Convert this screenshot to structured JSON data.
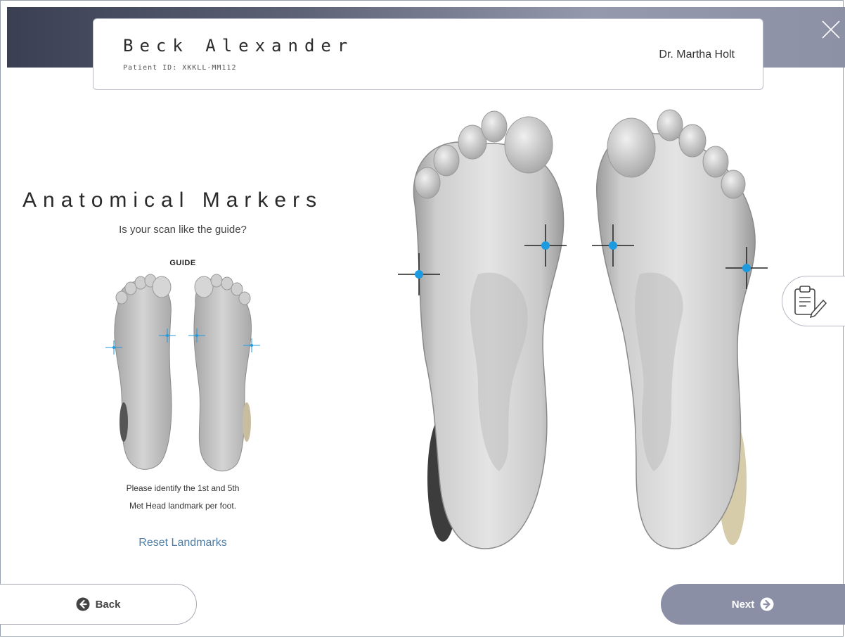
{
  "header": {
    "patient_name": "Beck Alexander",
    "patient_id": "Patient ID: XKKLL-MM112",
    "doctor": "Dr. Martha Holt"
  },
  "panel": {
    "title": "Anatomical Markers",
    "subtitle": "Is your scan like the guide?",
    "guide_label": "GUIDE",
    "instruction_line1": "Please identify the 1st and 5th",
    "instruction_line2": "Met Head landmark per foot.",
    "reset_label": "Reset Landmarks"
  },
  "nav": {
    "back_label": "Back",
    "next_label": "Next"
  },
  "icons": {
    "close": "close-icon",
    "notes": "clipboard-edit-icon",
    "back": "arrow-left-circle-icon",
    "next": "arrow-right-circle-icon"
  },
  "colors": {
    "accent": "#8b8fa6",
    "marker": "#1e9be0",
    "link": "#4f7ea6"
  }
}
